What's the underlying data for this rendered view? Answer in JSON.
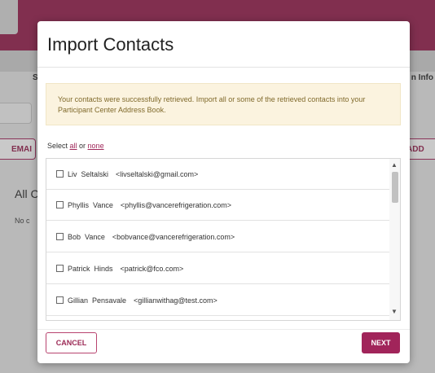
{
  "background": {
    "tab_left": "S",
    "tab_right": "n Info",
    "email_button": "EMAI",
    "add_button": "ADD",
    "heading": "All C",
    "note": "No c"
  },
  "modal": {
    "title": "Import Contacts",
    "alert": "Your contacts were successfully retrieved. Import all or some of the retrieved contacts into your Participant Center Address Book.",
    "select_prefix": "Select ",
    "select_all": "all",
    "select_or": " or ",
    "select_none": "none",
    "contacts": [
      {
        "name": "Liv  Seltalski",
        "email": "<livseltalski@gmail.com>",
        "checked": false
      },
      {
        "name": "Phyllis  Vance",
        "email": "<phyllis@vancerefrigeration.com>",
        "checked": false
      },
      {
        "name": "Bob  Vance",
        "email": "<bobvance@vancerefrigeration.com>",
        "checked": false
      },
      {
        "name": "Patrick  Hinds",
        "email": "<patrick@fco.com>",
        "checked": false
      },
      {
        "name": "Gillian  Pensavale",
        "email": "<gillianwithag@test.com>",
        "checked": false
      }
    ],
    "cancel_label": "CANCEL",
    "next_label": "NEXT"
  },
  "colors": {
    "brand": "#9c2a56",
    "alert_bg": "#fbf3df",
    "alert_text": "#806a2c"
  }
}
